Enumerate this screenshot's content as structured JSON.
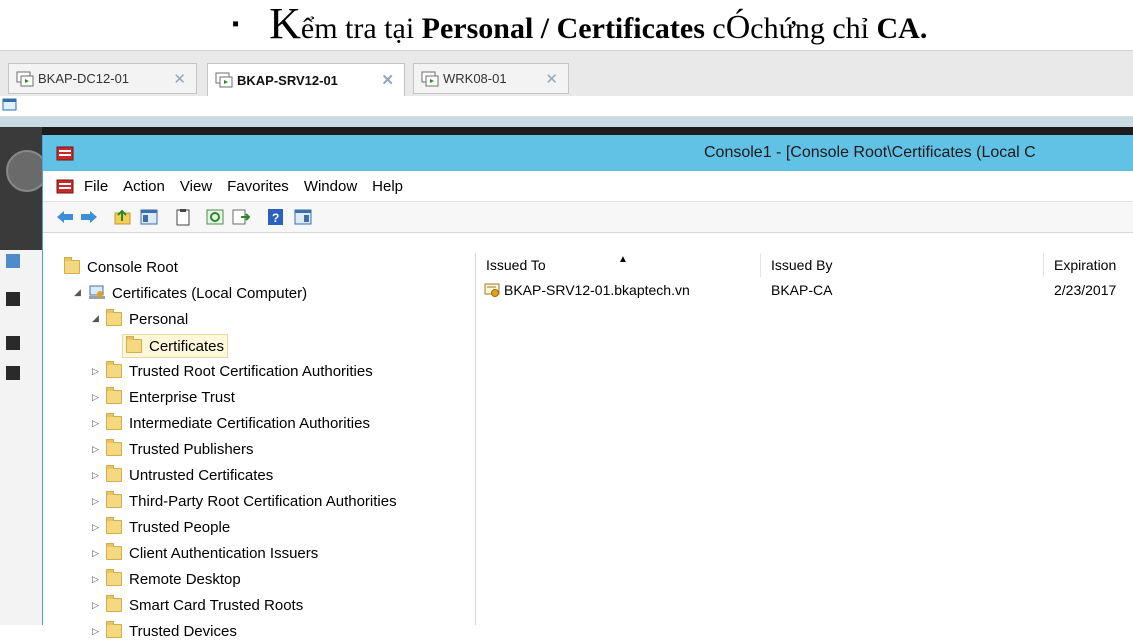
{
  "heading": {
    "bullet": "▪",
    "part1": "K",
    "part2": "ểm tra tại ",
    "bold1": "Personal / Certificates",
    "part3": " c",
    "part4": "Ó",
    "part5": "chứng chỉ ",
    "bold2": "CA."
  },
  "tabs": [
    {
      "label": "BKAP-DC12-01",
      "close": "✕"
    },
    {
      "label": "BKAP-SRV12-01",
      "close": "✕"
    },
    {
      "label": "WRK08-01",
      "close": "✕"
    }
  ],
  "window": {
    "title": "Console1 - [Console Root\\Certificates (Local C"
  },
  "menu": [
    "File",
    "Action",
    "View",
    "Favorites",
    "Window",
    "Help"
  ],
  "toolbar_icons": [
    "back-arrow-icon",
    "forward-arrow-icon",
    "up-folder-icon",
    "show-hide-tree-icon",
    "clipboard-icon",
    "refresh-icon",
    "export-list-icon",
    "help-icon",
    "show-action-pane-icon"
  ],
  "tree": {
    "root": "Console Root",
    "certs": "Certificates (Local Computer)",
    "personal": "Personal",
    "personal_certs": "Certificates",
    "stores": [
      "Trusted Root Certification Authorities",
      "Enterprise Trust",
      "Intermediate Certification Authorities",
      "Trusted Publishers",
      "Untrusted Certificates",
      "Third-Party Root Certification Authorities",
      "Trusted People",
      "Client Authentication Issuers",
      "Remote Desktop",
      "Smart Card Trusted Roots",
      "Trusted Devices"
    ]
  },
  "list": {
    "columns": [
      "Issued To",
      "Issued By",
      "Expiration"
    ],
    "rows": [
      {
        "issued_to": "BKAP-SRV12-01.bkaptech.vn",
        "issued_by": "BKAP-CA",
        "expiration": "2/23/2017"
      }
    ]
  }
}
